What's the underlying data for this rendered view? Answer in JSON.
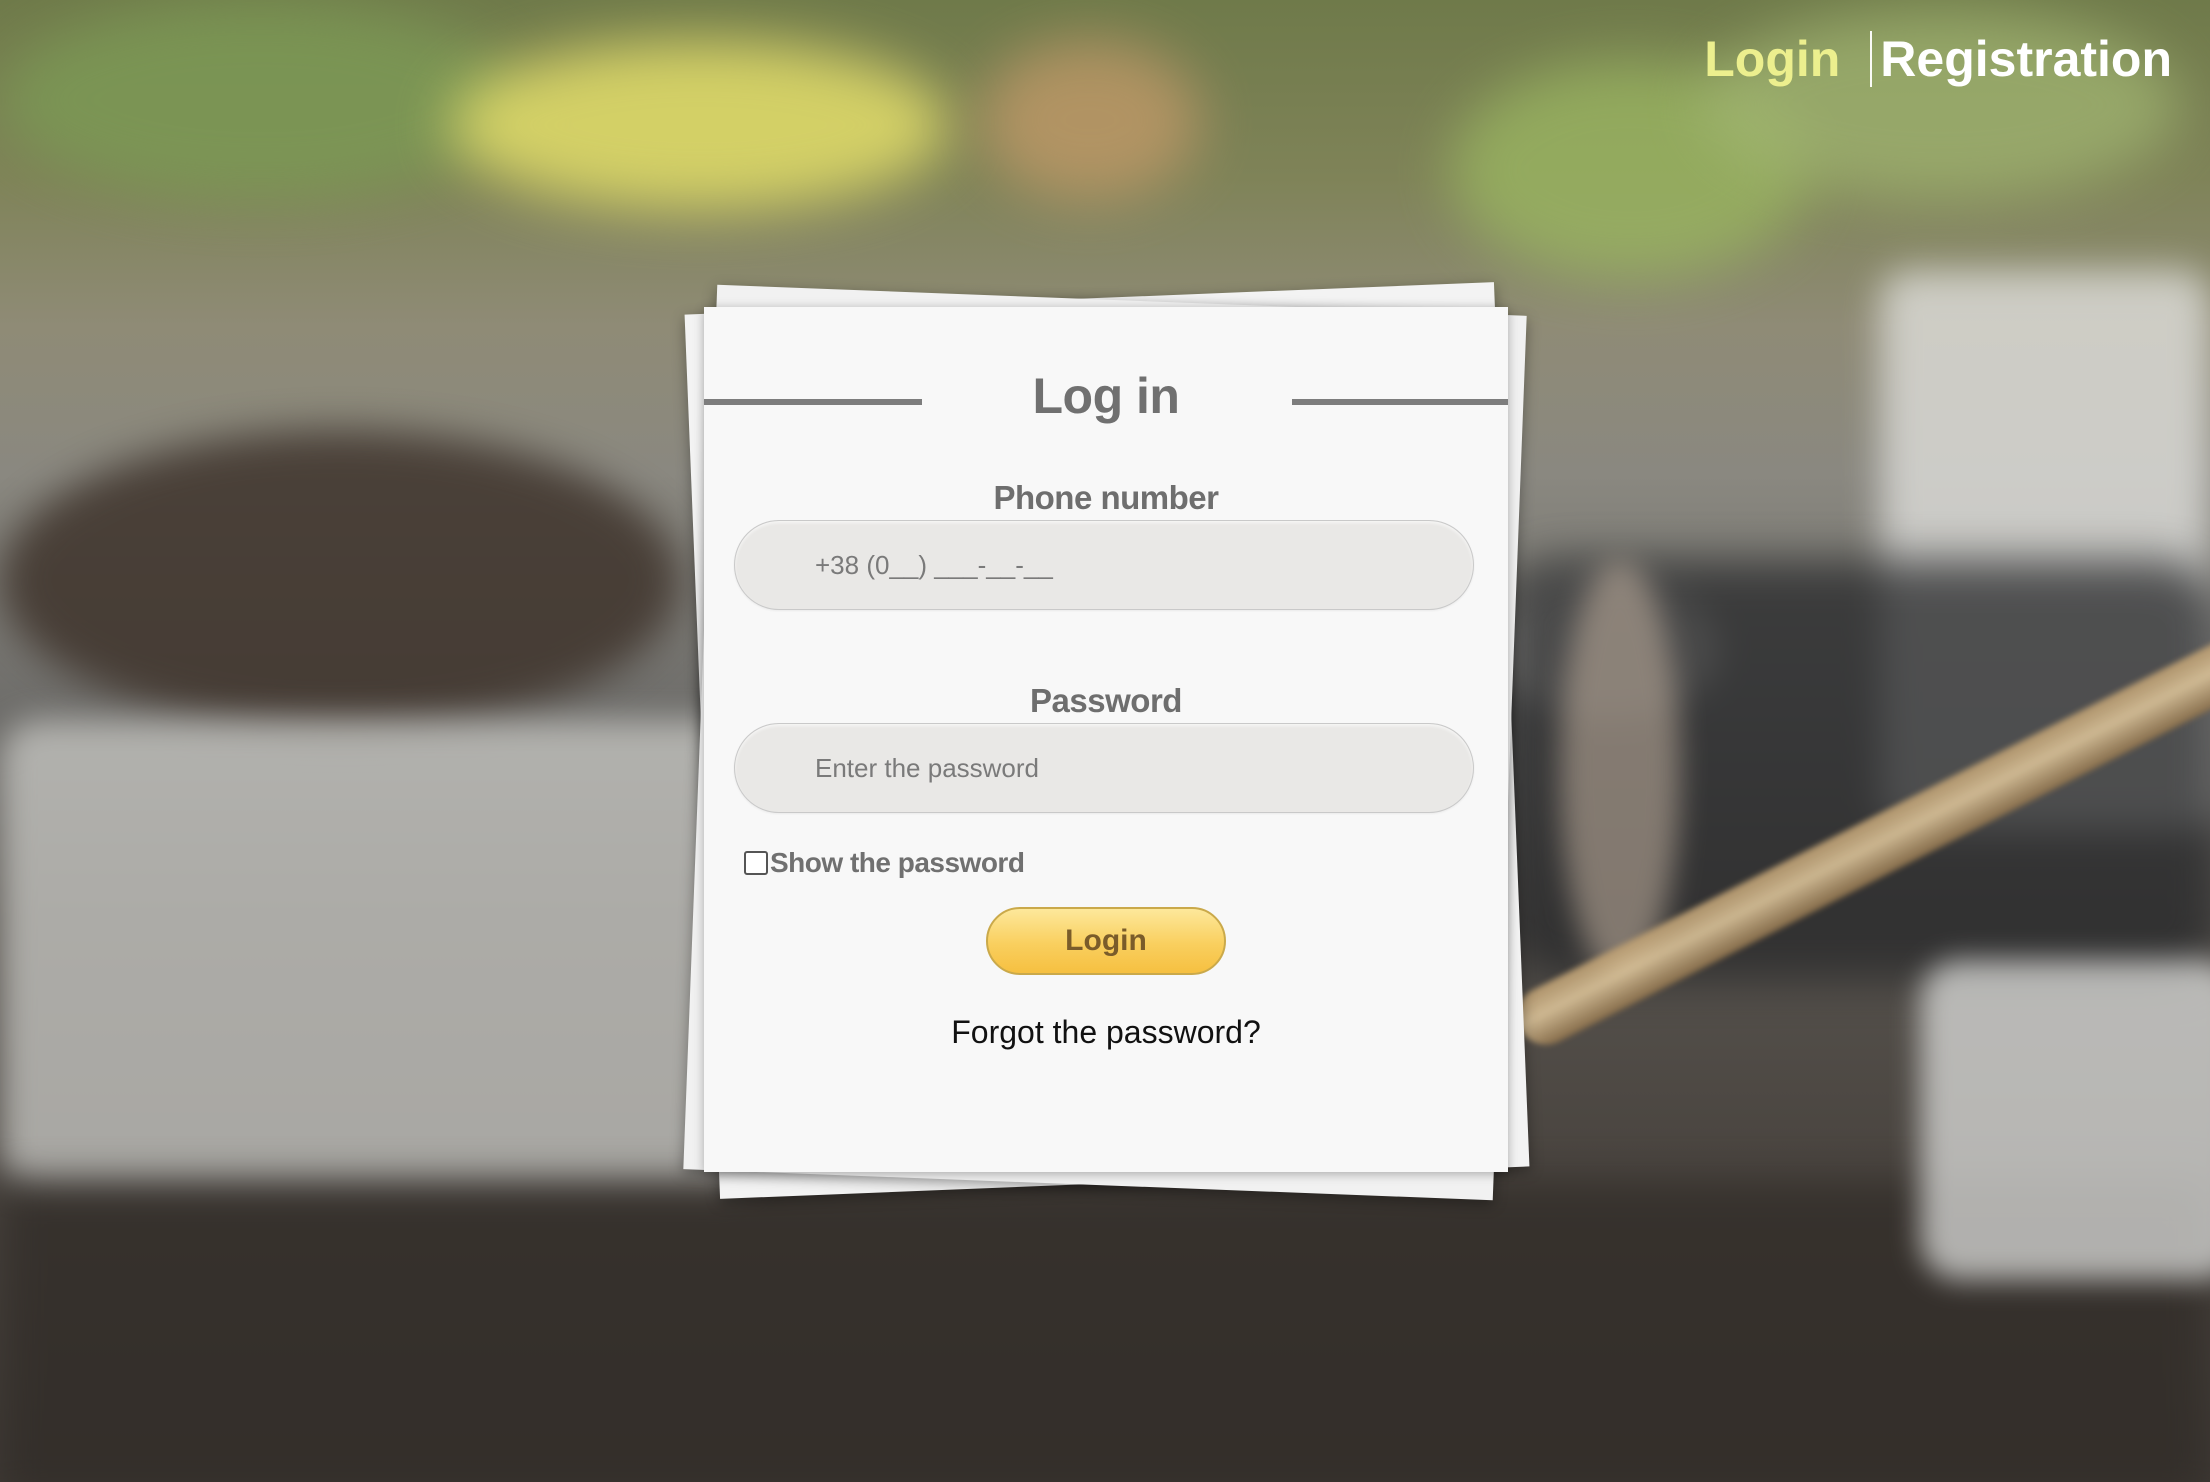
{
  "nav": {
    "login": "Login",
    "registration": "Registration"
  },
  "form": {
    "title": "Log in",
    "phone_label": "Phone number",
    "phone_placeholder": "+38 (0__) ___-__-__",
    "password_label": "Password",
    "password_placeholder": "Enter the password",
    "show_password_label": "Show the password",
    "show_password_checked": false,
    "login_button": "Login",
    "forgot_link": "Forgot the password?"
  },
  "colors": {
    "nav_login_active": "#ecef8e",
    "nav_registration": "#ffffff",
    "button_gradient_top": "#fde89b",
    "button_gradient_bottom": "#f6c041",
    "card_background": "#f8f8f8",
    "label_text": "#707070"
  }
}
